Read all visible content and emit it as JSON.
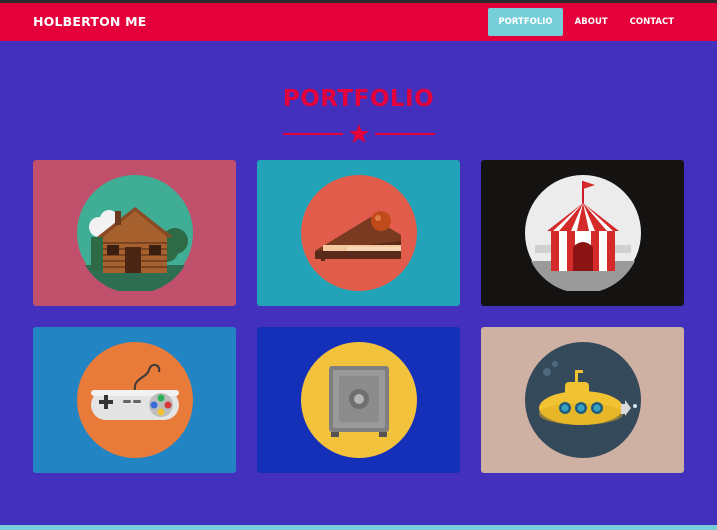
{
  "header": {
    "brand": "HOLBERTON ME",
    "nav": [
      "PORTFOLIO",
      "ABOUT",
      "CONTACT"
    ]
  },
  "portfolio": {
    "title": "PORTFOLIO"
  },
  "colors": {
    "page_background": "#4331bd",
    "navbar": "#e3003b",
    "accent_red": "#e3003b",
    "active_nav": "#76cfd8"
  },
  "tiles": [
    {
      "icon": "log-cabin-icon",
      "background": "#c0506b"
    },
    {
      "icon": "cake-slice-icon",
      "background": "#23a3b7"
    },
    {
      "icon": "circus-tent-icon",
      "background": "#151212"
    },
    {
      "icon": "game-controller-icon",
      "background": "#2384c3"
    },
    {
      "icon": "safe-vault-icon",
      "background": "#1530b8"
    },
    {
      "icon": "submarine-icon",
      "background": "#cfb1a3"
    }
  ]
}
